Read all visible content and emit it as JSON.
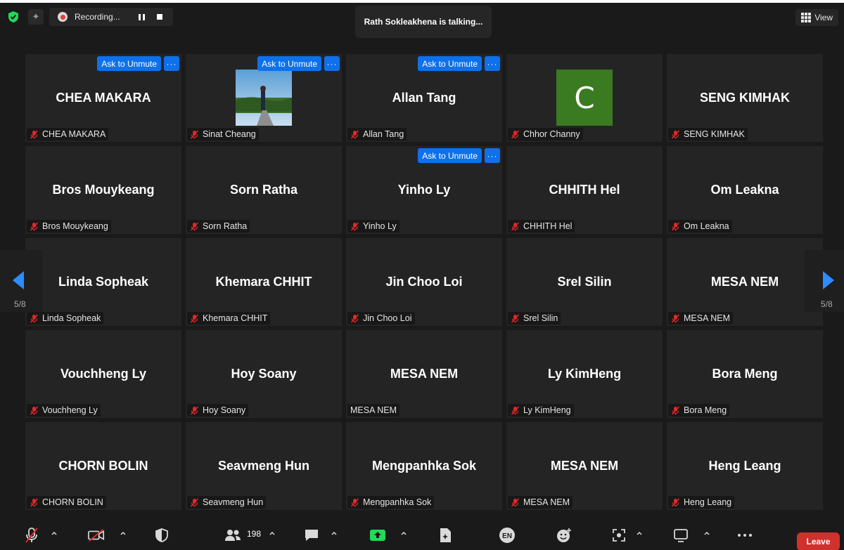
{
  "recording": {
    "label": "Recording..."
  },
  "talking": {
    "text": "Rath Sokleakhena is talking..."
  },
  "view": {
    "label": "View"
  },
  "ask_to_unmute": "Ask to Unmute",
  "more_label": "···",
  "avatar_letter": "C",
  "pagination": {
    "left": "5/8",
    "right": "5/8"
  },
  "participants": [
    {
      "display": "CHEA MAKARA",
      "label": "CHEA MAKARA",
      "muted": true,
      "unmute_btn": true
    },
    {
      "display": "",
      "label": "Sinat Cheang",
      "muted": true,
      "unmute_btn": true,
      "photo": true
    },
    {
      "display": "Allan Tang",
      "label": "Allan Tang",
      "muted": true,
      "unmute_btn": true
    },
    {
      "display": "",
      "label": "Chhor Channy",
      "muted": true,
      "avatar": true
    },
    {
      "display": "SENG KIMHAK",
      "label": "SENG KIMHAK",
      "muted": true
    },
    {
      "display": "Bros Mouykeang",
      "label": "Bros Mouykeang",
      "muted": true
    },
    {
      "display": "Sorn Ratha",
      "label": "Sorn Ratha",
      "muted": true
    },
    {
      "display": "Yinho Ly",
      "label": "Yinho Ly",
      "muted": true,
      "unmute_btn": true
    },
    {
      "display": "CHHITH Hel",
      "label": "CHHITH Hel",
      "muted": true
    },
    {
      "display": "Om Leakna",
      "label": "Om Leakna",
      "muted": true
    },
    {
      "display": "Linda Sopheak",
      "label": "Linda Sopheak",
      "muted": true
    },
    {
      "display": "Khemara CHHIT",
      "label": "Khemara CHHIT",
      "muted": true
    },
    {
      "display": "Jin Choo Loi",
      "label": "Jin Choo Loi",
      "muted": true
    },
    {
      "display": "Srel Silin",
      "label": "Srel Silin",
      "muted": true
    },
    {
      "display": "MESA NEM",
      "label": "MESA NEM",
      "muted": true
    },
    {
      "display": "Vouchheng Ly",
      "label": "Vouchheng Ly",
      "muted": true
    },
    {
      "display": "Hoy Soany",
      "label": "Hoy Soany",
      "muted": true
    },
    {
      "display": "MESA NEM",
      "label": "MESA NEM",
      "muted": false
    },
    {
      "display": "Ly KimHeng",
      "label": "Ly KimHeng",
      "muted": true
    },
    {
      "display": "Bora Meng",
      "label": "Bora Meng",
      "muted": true
    },
    {
      "display": "CHORN BOLIN",
      "label": "CHORN BOLIN",
      "muted": true
    },
    {
      "display": "Seavmeng Hun",
      "label": "Seavmeng Hun",
      "muted": true
    },
    {
      "display": "Mengpanhka Sok",
      "label": "Mengpanhka Sok",
      "muted": true
    },
    {
      "display": "MESA NEM",
      "label": "MESA NEM",
      "muted": true
    },
    {
      "display": "Heng Leang",
      "label": "Heng Leang",
      "muted": true
    }
  ],
  "toolbar": {
    "participants_count": "198",
    "translation_icon_text": "EN",
    "leave": "Leave"
  },
  "colors": {
    "accent": "#0e71eb",
    "leave": "#d0312d",
    "avatar": "#3a7a20",
    "mute": "#e02828"
  }
}
